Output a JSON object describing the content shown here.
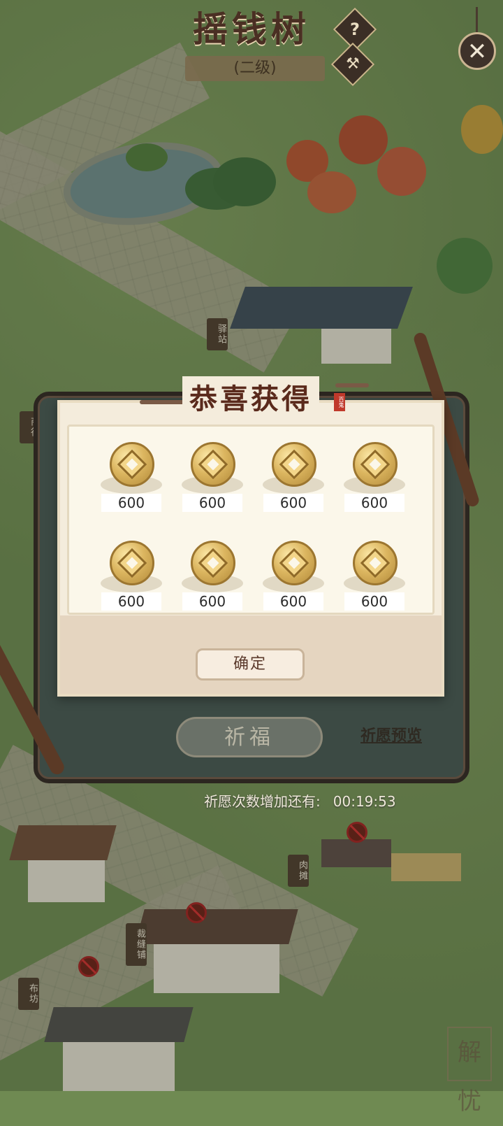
{
  "header": {
    "title": "摇钱树",
    "level": "(二级)",
    "help_icon": "?",
    "close_icon": "✕"
  },
  "scene_signs": {
    "shop_left": "商行",
    "station": "驿站",
    "meat": "肉摊",
    "tailor": "裁缝铺",
    "cloth": "布坊"
  },
  "popup": {
    "title": "恭喜获得",
    "seal": "百鬼",
    "confirm_label": "确定",
    "rewards": [
      {
        "icon": "copper-coin-icon",
        "amount": "600"
      },
      {
        "icon": "copper-coin-icon",
        "amount": "600"
      },
      {
        "icon": "copper-coin-icon",
        "amount": "600"
      },
      {
        "icon": "copper-coin-icon",
        "amount": "600"
      },
      {
        "icon": "copper-coin-icon",
        "amount": "600"
      },
      {
        "icon": "copper-coin-icon",
        "amount": "600"
      },
      {
        "icon": "copper-coin-icon",
        "amount": "600"
      },
      {
        "icon": "copper-coin-icon",
        "amount": "600"
      }
    ]
  },
  "panel": {
    "pray_label": "祈福",
    "preview_label": "祈愿预览",
    "countdown_label": "祈愿次数增加还有:",
    "countdown_time": "00:19:53"
  },
  "watermark": "解忧"
}
